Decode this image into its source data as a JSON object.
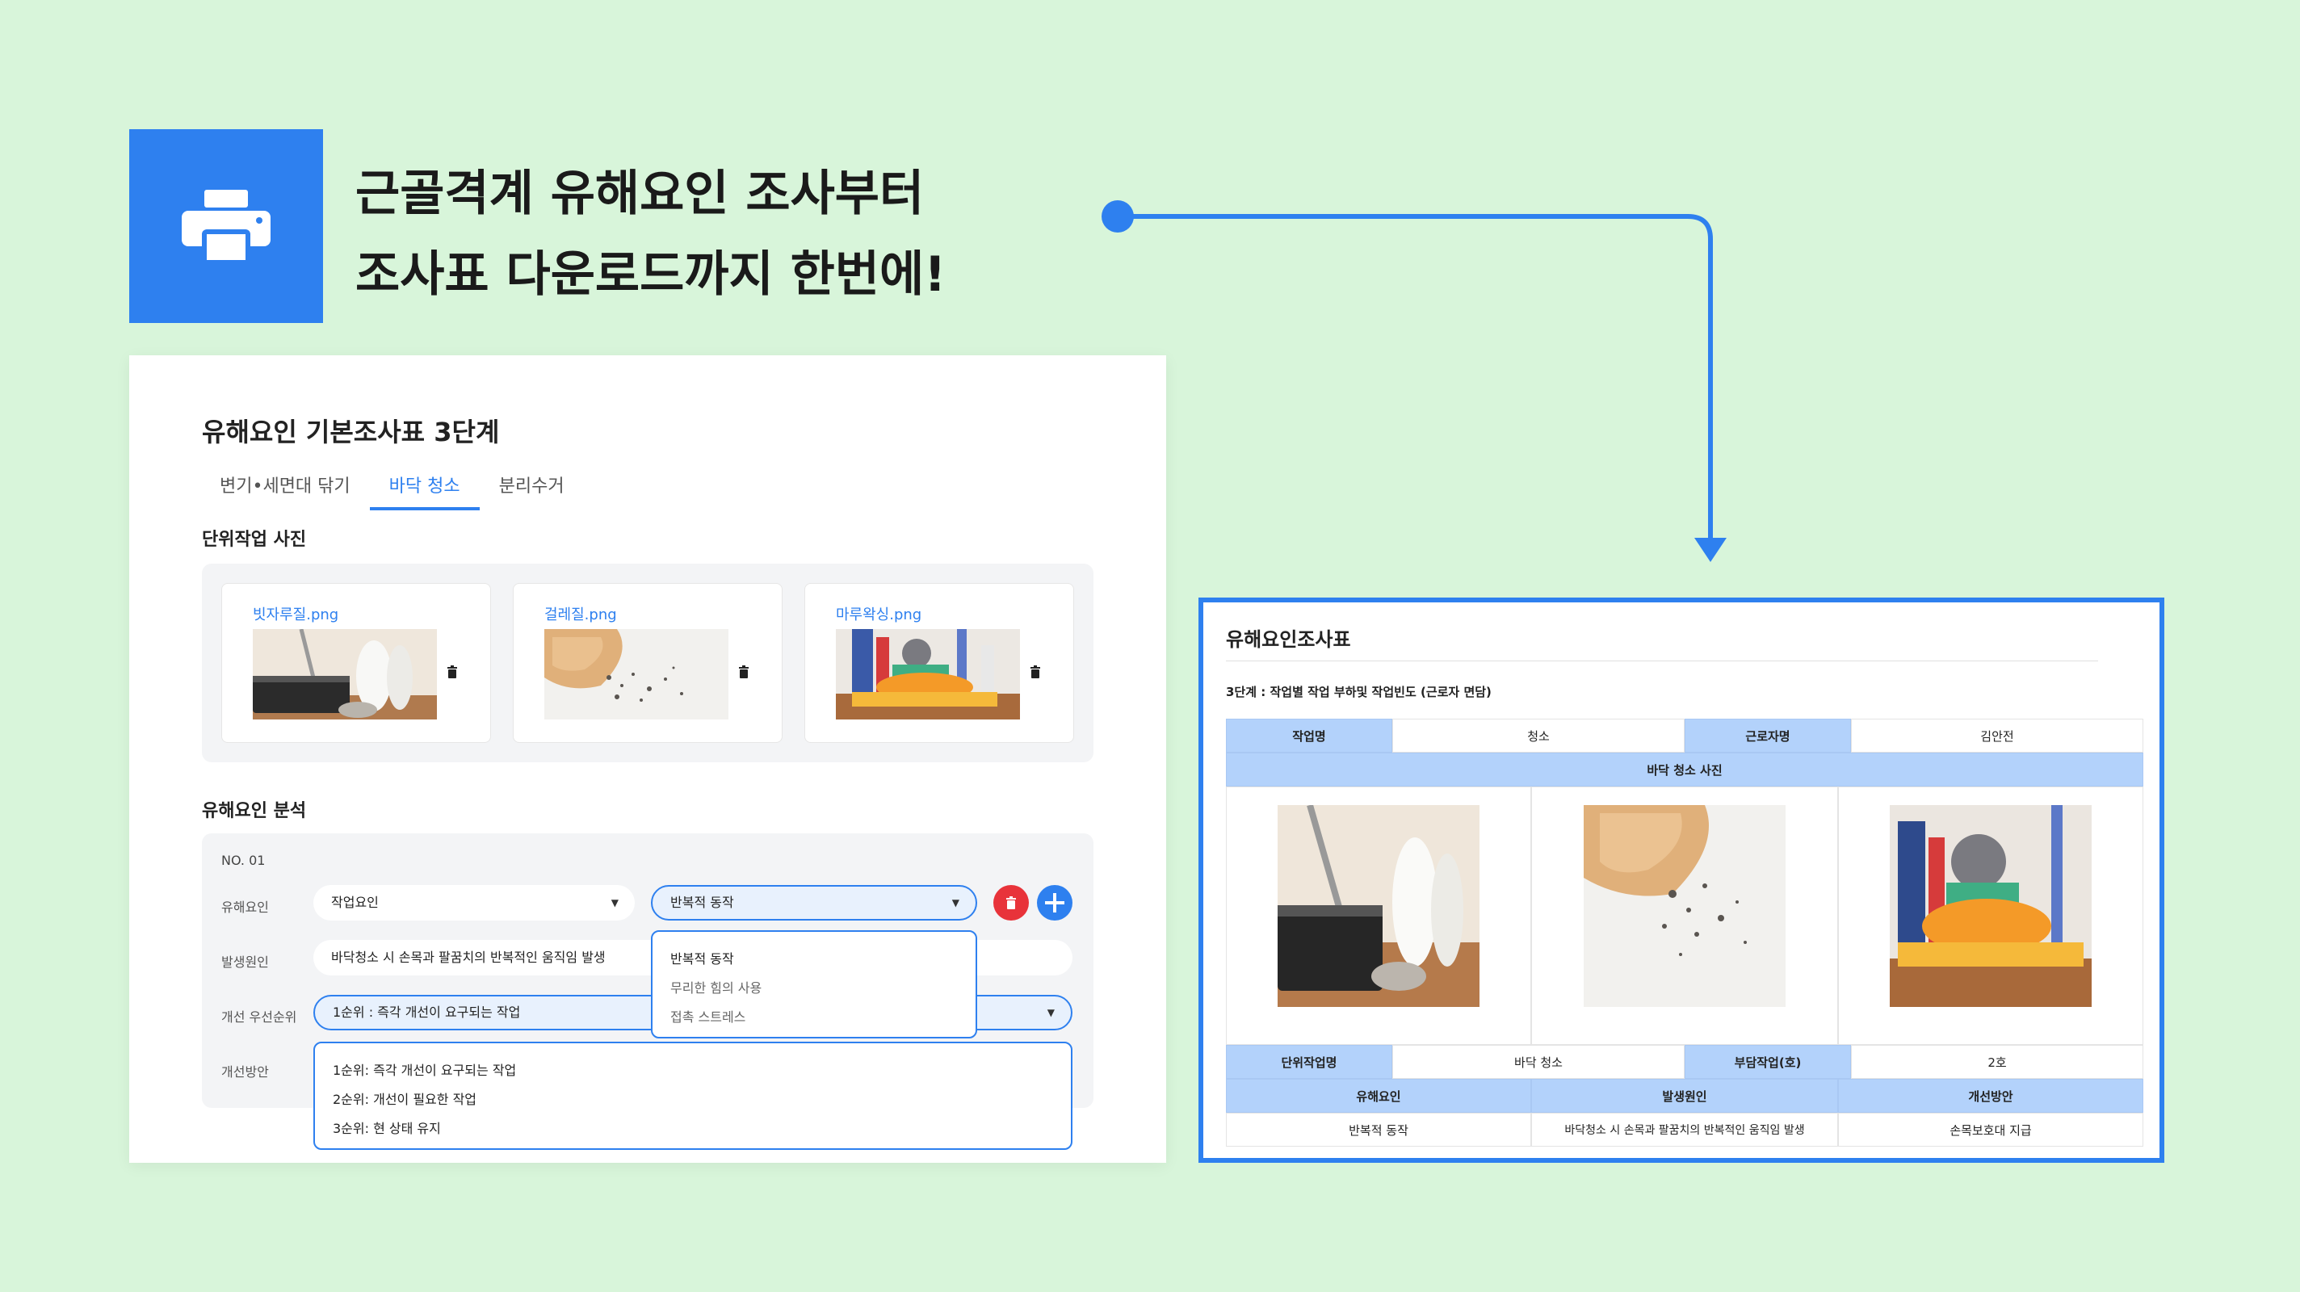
{
  "hero": {
    "line1": "근골격계 유해요인 조사부터",
    "line2": "조사표 다운로드까지 한번에!",
    "icon": "printer-icon",
    "accent": "#2e80ef",
    "background": "#d8f5da"
  },
  "form": {
    "title": "유해요인 기본조사표 3단계",
    "tabs": [
      {
        "label": "변기•세면대 닦기"
      },
      {
        "label": "바닥 청소"
      },
      {
        "label": "분리수거"
      }
    ],
    "active_tab": "바닥 청소",
    "photos_label": "단위작업 사진",
    "photos": [
      {
        "filename": "빗자루질.png"
      },
      {
        "filename": "걸레질.png"
      },
      {
        "filename": "마루왁싱.png"
      }
    ],
    "analysis_label": "유해요인 분석",
    "entry": {
      "number": "NO. 01",
      "factor_label": "유해요인",
      "factor_type": "작업요인",
      "factor_detail": "반복적 동작",
      "cause_label": "발생원인",
      "cause_value": "바닥청소 시 손목과 팔꿈치의 반복적인 움직임 발생",
      "priority_label": "개선 우선순위",
      "priority_value": "1순위 : 즉각 개선이 요구되는 작업",
      "plan_label": "개선방안"
    },
    "factor_options": [
      "반복적 동작",
      "무리한 힘의 사용",
      "접촉 스트레스"
    ],
    "priority_options": [
      "1순위: 즉각 개선이 요구되는 작업",
      "2순위: 개선이 필요한 작업",
      "3순위: 현 상태 유지"
    ],
    "delete_color": "#e8333a",
    "add_color": "#2e80ef"
  },
  "report": {
    "title": "유해요인조사표",
    "subtitle": "3단계 : 작업별 작업 부하및 작업빈도 (근로자 면담)",
    "work_name_label": "작업명",
    "work_name": "청소",
    "worker_label": "근로자명",
    "worker": "김안전",
    "photo_header": "바닥 청소 사진",
    "unit_task_label": "단위작업명",
    "unit_task": "바닥 청소",
    "burden_label": "부담작업(호)",
    "burden": "2호",
    "factor_label": "유해요인",
    "cause_label": "발생원인",
    "plan_label": "개선방안",
    "factor": "반복적 동작",
    "cause": "바닥청소 시 손목과 팔꿈치의 반복적인 움직임 발생",
    "plan": "손목보호대 지급",
    "header_color": "#b3d2fb"
  }
}
